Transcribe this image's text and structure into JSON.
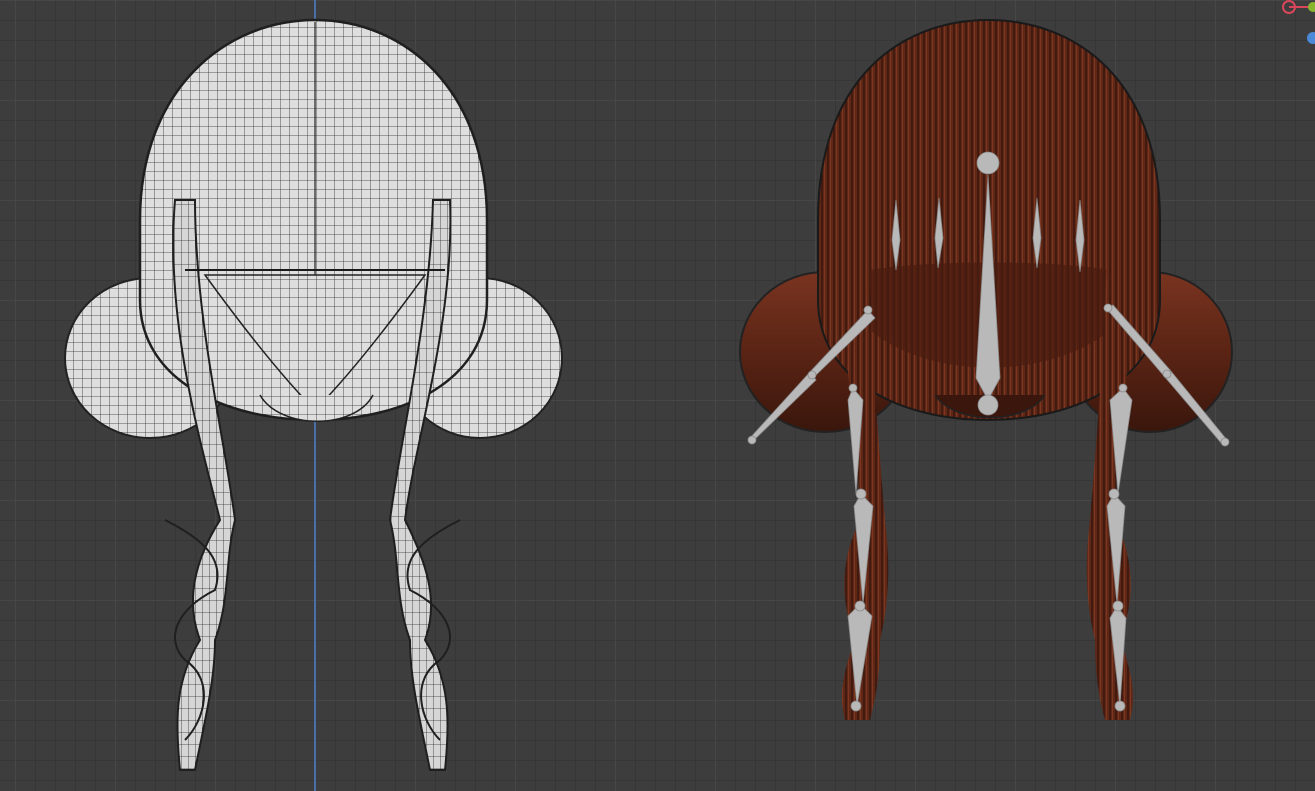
{
  "colors": {
    "background": "#3d3d3d",
    "grid_minor": "#363636",
    "grid_major": "#474747",
    "axis_y": "#4a6fa8",
    "wire_fill": "#dcdcdc",
    "wire_line": "#2a2a2a",
    "hair_dark": "#3a1a10",
    "hair_mid": "#6b2e1a",
    "hair_light": "#8a3c22",
    "bone": "#b8b8b8",
    "gizmo_x": "#d9465a",
    "gizmo_y": "#88b62f",
    "gizmo_z": "#4a8ad9"
  },
  "objects": [
    {
      "name": "hair-wireframe",
      "shading": "wireframe"
    },
    {
      "name": "hair-rigged",
      "shading": "material",
      "armature": "hair-armature"
    }
  ],
  "gizmo_icons": [
    "x-axis-icon",
    "y-axis-icon",
    "z-axis-icon"
  ]
}
